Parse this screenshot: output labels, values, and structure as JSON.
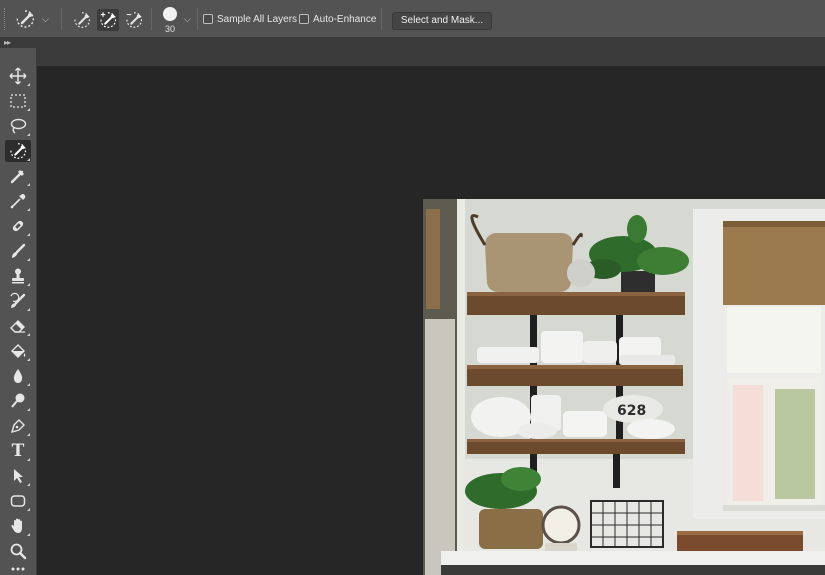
{
  "options_bar": {
    "modes": [
      "new-selection",
      "add-to-selection",
      "subtract-from-selection"
    ],
    "active_mode": "add-to-selection",
    "brush_size": "30",
    "sample_all_layers_label": "Sample All Layers",
    "sample_all_layers_checked": false,
    "auto_enhance_label": "Auto-Enhance",
    "auto_enhance_checked": false,
    "select_and_mask_label": "Select and Mask..."
  },
  "tools": [
    {
      "name": "move-tool",
      "icon": "move-icon"
    },
    {
      "name": "rectangular-marquee-tool",
      "icon": "marquee-icon"
    },
    {
      "name": "lasso-tool",
      "icon": "lasso-icon"
    },
    {
      "name": "quick-selection-tool",
      "icon": "quick-selection-icon",
      "active": true
    },
    {
      "name": "crop-tool",
      "icon": "crop-icon"
    },
    {
      "name": "eyedropper-tool",
      "icon": "eyedropper-icon"
    },
    {
      "name": "healing-brush-tool",
      "icon": "bandage-icon"
    },
    {
      "name": "brush-tool",
      "icon": "brush-icon"
    },
    {
      "name": "clone-stamp-tool",
      "icon": "stamp-icon"
    },
    {
      "name": "history-brush-tool",
      "icon": "history-brush-icon"
    },
    {
      "name": "eraser-tool",
      "icon": "eraser-icon"
    },
    {
      "name": "paint-bucket-tool",
      "icon": "paint-bucket-icon"
    },
    {
      "name": "blur-tool",
      "icon": "drop-icon"
    },
    {
      "name": "dodge-tool",
      "icon": "dodge-icon"
    },
    {
      "name": "pen-tool",
      "icon": "pen-icon"
    },
    {
      "name": "type-tool",
      "icon": "type-icon",
      "glyph": "T"
    },
    {
      "name": "path-selection-tool",
      "icon": "arrow-icon"
    },
    {
      "name": "shape-tool",
      "icon": "rounded-rect-icon"
    },
    {
      "name": "hand-tool",
      "icon": "hand-icon"
    },
    {
      "name": "zoom-tool",
      "icon": "zoom-icon"
    },
    {
      "name": "more-tools",
      "icon": "ellipsis-icon"
    }
  ],
  "photo": {
    "description_visible_text": "628",
    "colors": {
      "wall": "#d9dcd6",
      "wood": "#6b4a2e",
      "plant": "#2f6b2a",
      "dish": "#f3f3f1",
      "bracket": "#1f1f1f",
      "blind": "#9a7a4c"
    }
  },
  "colors": {
    "ui_dark": "#262626",
    "ui_panel": "#535353",
    "ui_bar": "#3b3b3b",
    "icon": "#e0e0e0"
  }
}
